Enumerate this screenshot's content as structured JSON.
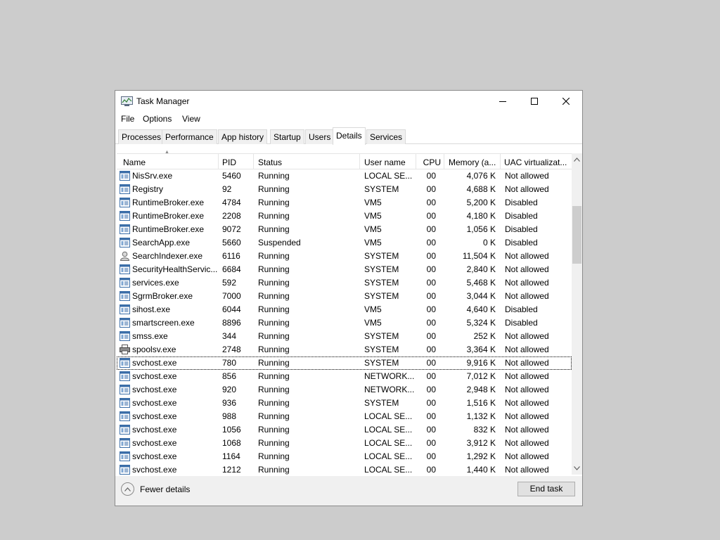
{
  "window": {
    "title": "Task Manager"
  },
  "menu": [
    "File",
    "Options",
    "View"
  ],
  "tabs": [
    {
      "label": "Processes",
      "active": false
    },
    {
      "label": "Performance",
      "active": false
    },
    {
      "label": "App history",
      "active": false
    },
    {
      "label": "Startup",
      "active": false
    },
    {
      "label": "Users",
      "active": false
    },
    {
      "label": "Details",
      "active": true
    },
    {
      "label": "Services",
      "active": false
    }
  ],
  "columns": [
    "Name",
    "PID",
    "Status",
    "User name",
    "CPU",
    "Memory (a...",
    "UAC virtualizat..."
  ],
  "rows": [
    {
      "name": "NisSrv.exe",
      "pid": "5460",
      "status": "Running",
      "user": "LOCAL SE...",
      "cpu": "00",
      "memory": "4,076 K",
      "uac": "Not allowed",
      "icon": "window-icon"
    },
    {
      "name": "Registry",
      "pid": "92",
      "status": "Running",
      "user": "SYSTEM",
      "cpu": "00",
      "memory": "4,688 K",
      "uac": "Not allowed",
      "icon": "window-icon"
    },
    {
      "name": "RuntimeBroker.exe",
      "pid": "4784",
      "status": "Running",
      "user": "VM5",
      "cpu": "00",
      "memory": "5,200 K",
      "uac": "Disabled",
      "icon": "window-icon"
    },
    {
      "name": "RuntimeBroker.exe",
      "pid": "2208",
      "status": "Running",
      "user": "VM5",
      "cpu": "00",
      "memory": "4,180 K",
      "uac": "Disabled",
      "icon": "window-icon"
    },
    {
      "name": "RuntimeBroker.exe",
      "pid": "9072",
      "status": "Running",
      "user": "VM5",
      "cpu": "00",
      "memory": "1,056 K",
      "uac": "Disabled",
      "icon": "window-icon"
    },
    {
      "name": "SearchApp.exe",
      "pid": "5660",
      "status": "Suspended",
      "user": "VM5",
      "cpu": "00",
      "memory": "0 K",
      "uac": "Disabled",
      "icon": "window-icon"
    },
    {
      "name": "SearchIndexer.exe",
      "pid": "6116",
      "status": "Running",
      "user": "SYSTEM",
      "cpu": "00",
      "memory": "11,504 K",
      "uac": "Not allowed",
      "icon": "user-icon"
    },
    {
      "name": "SecurityHealthServic...",
      "pid": "6684",
      "status": "Running",
      "user": "SYSTEM",
      "cpu": "00",
      "memory": "2,840 K",
      "uac": "Not allowed",
      "icon": "window-icon"
    },
    {
      "name": "services.exe",
      "pid": "592",
      "status": "Running",
      "user": "SYSTEM",
      "cpu": "00",
      "memory": "5,468 K",
      "uac": "Not allowed",
      "icon": "window-icon"
    },
    {
      "name": "SgrmBroker.exe",
      "pid": "7000",
      "status": "Running",
      "user": "SYSTEM",
      "cpu": "00",
      "memory": "3,044 K",
      "uac": "Not allowed",
      "icon": "window-icon"
    },
    {
      "name": "sihost.exe",
      "pid": "6044",
      "status": "Running",
      "user": "VM5",
      "cpu": "00",
      "memory": "4,640 K",
      "uac": "Disabled",
      "icon": "window-icon"
    },
    {
      "name": "smartscreen.exe",
      "pid": "8896",
      "status": "Running",
      "user": "VM5",
      "cpu": "00",
      "memory": "5,324 K",
      "uac": "Disabled",
      "icon": "window-icon"
    },
    {
      "name": "smss.exe",
      "pid": "344",
      "status": "Running",
      "user": "SYSTEM",
      "cpu": "00",
      "memory": "252 K",
      "uac": "Not allowed",
      "icon": "window-icon"
    },
    {
      "name": "spoolsv.exe",
      "pid": "2748",
      "status": "Running",
      "user": "SYSTEM",
      "cpu": "00",
      "memory": "3,364 K",
      "uac": "Not allowed",
      "icon": "printer-icon"
    },
    {
      "name": "svchost.exe",
      "pid": "780",
      "status": "Running",
      "user": "SYSTEM",
      "cpu": "00",
      "memory": "9,916 K",
      "uac": "Not allowed",
      "icon": "window-icon",
      "selected": true
    },
    {
      "name": "svchost.exe",
      "pid": "856",
      "status": "Running",
      "user": "NETWORK...",
      "cpu": "00",
      "memory": "7,012 K",
      "uac": "Not allowed",
      "icon": "window-icon"
    },
    {
      "name": "svchost.exe",
      "pid": "920",
      "status": "Running",
      "user": "NETWORK...",
      "cpu": "00",
      "memory": "2,948 K",
      "uac": "Not allowed",
      "icon": "window-icon"
    },
    {
      "name": "svchost.exe",
      "pid": "936",
      "status": "Running",
      "user": "SYSTEM",
      "cpu": "00",
      "memory": "1,516 K",
      "uac": "Not allowed",
      "icon": "window-icon"
    },
    {
      "name": "svchost.exe",
      "pid": "988",
      "status": "Running",
      "user": "LOCAL SE...",
      "cpu": "00",
      "memory": "1,132 K",
      "uac": "Not allowed",
      "icon": "window-icon"
    },
    {
      "name": "svchost.exe",
      "pid": "1056",
      "status": "Running",
      "user": "LOCAL SE...",
      "cpu": "00",
      "memory": "832 K",
      "uac": "Not allowed",
      "icon": "window-icon"
    },
    {
      "name": "svchost.exe",
      "pid": "1068",
      "status": "Running",
      "user": "LOCAL SE...",
      "cpu": "00",
      "memory": "3,912 K",
      "uac": "Not allowed",
      "icon": "window-icon"
    },
    {
      "name": "svchost.exe",
      "pid": "1164",
      "status": "Running",
      "user": "LOCAL SE...",
      "cpu": "00",
      "memory": "1,292 K",
      "uac": "Not allowed",
      "icon": "window-icon"
    },
    {
      "name": "svchost.exe",
      "pid": "1212",
      "status": "Running",
      "user": "LOCAL SE...",
      "cpu": "00",
      "memory": "1,440 K",
      "uac": "Not allowed",
      "icon": "window-icon"
    }
  ],
  "footer": {
    "fewer_details": "Fewer details",
    "end_task": "End task"
  }
}
